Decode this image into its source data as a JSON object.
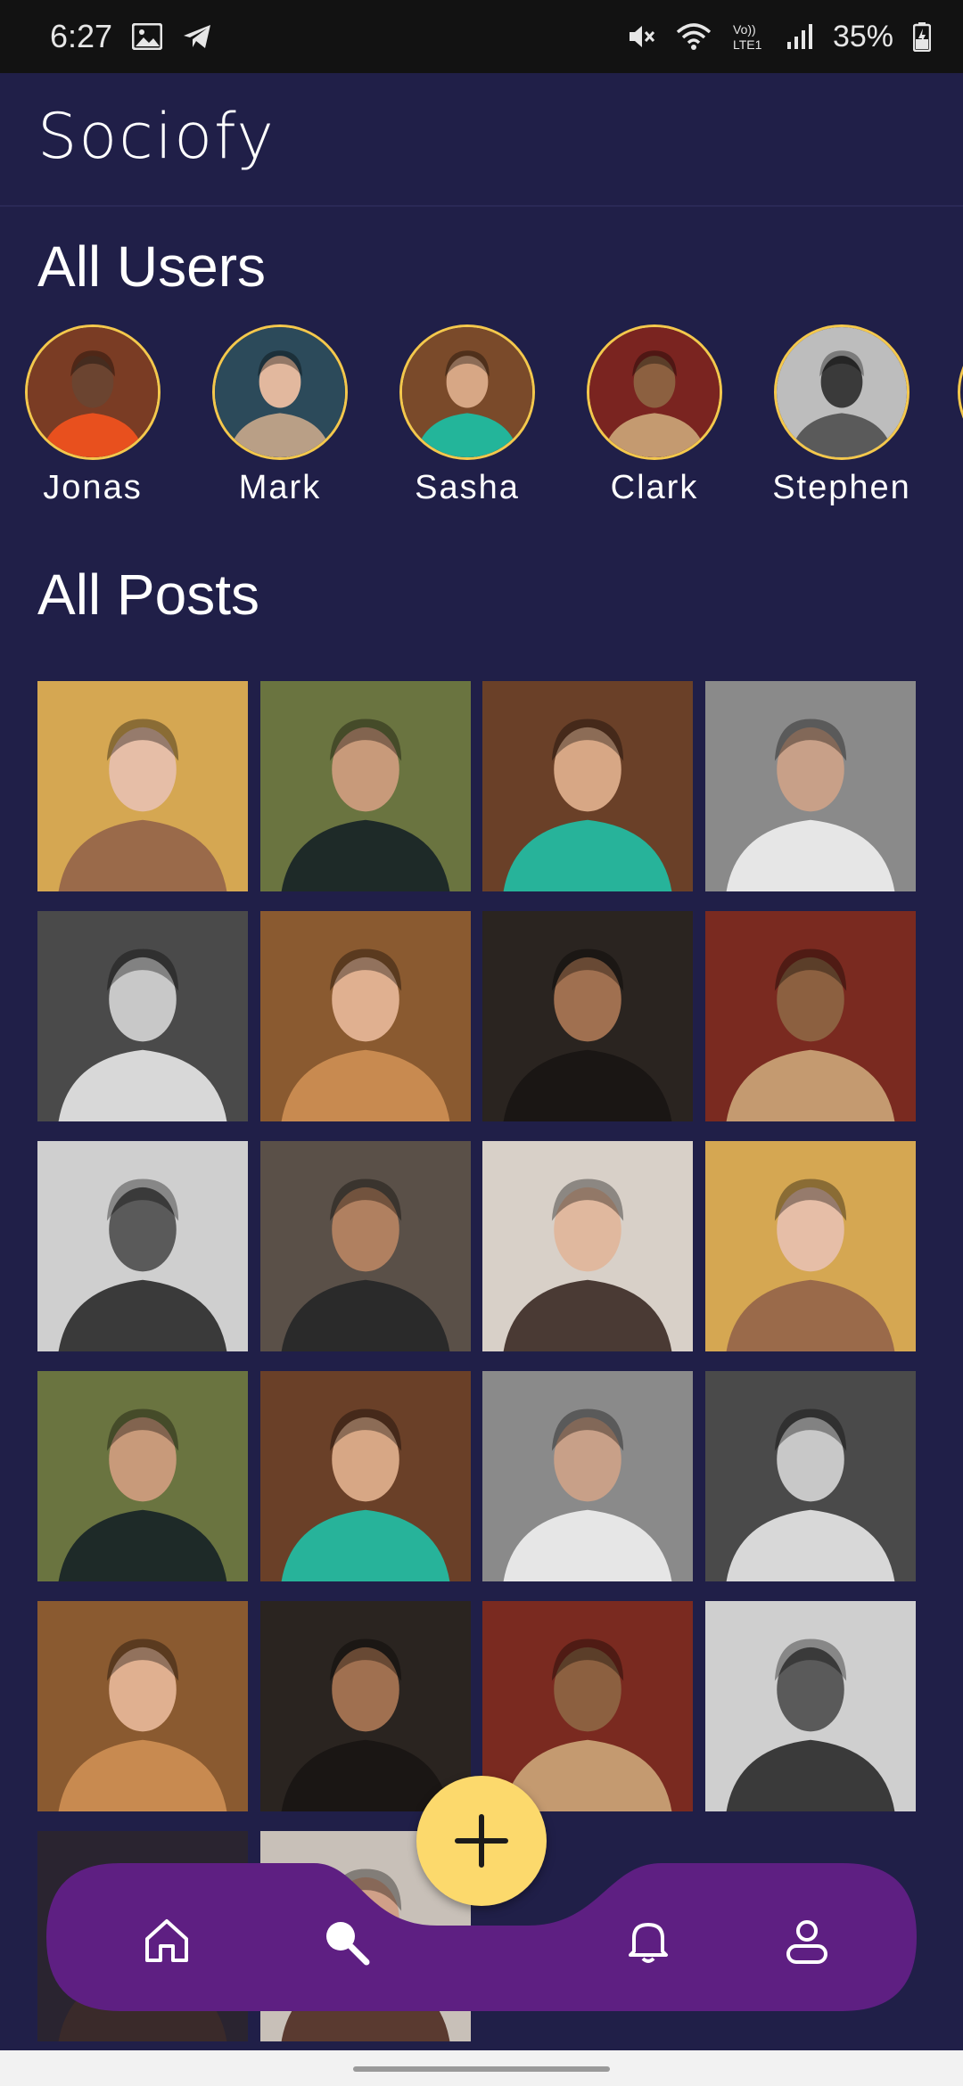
{
  "status_bar": {
    "time": "6:27",
    "battery": "35%",
    "icons_left": [
      "gallery-icon",
      "telegram-icon"
    ],
    "icons_right": [
      "mute-icon",
      "wifi-icon",
      "volte-icon",
      "signal-icon",
      "battery-icon"
    ]
  },
  "app": {
    "title": "Sociofy"
  },
  "users_section": {
    "title": "All Users",
    "users": [
      {
        "name": "Jonas",
        "bg": "#7a3c24",
        "fg": "#e8501e",
        "skin": "#6b4430"
      },
      {
        "name": "Mark",
        "bg": "#2c4a5a",
        "fg": "#b99f86",
        "skin": "#e2b89e"
      },
      {
        "name": "Sasha",
        "bg": "#7a4a2a",
        "fg": "#23b59a",
        "skin": "#d7a785"
      },
      {
        "name": "Clark",
        "bg": "#7a2420",
        "fg": "#c49a70",
        "skin": "#8c6040"
      },
      {
        "name": "Stephen",
        "bg": "#bdbdbd",
        "fg": "#5a5a5a",
        "skin": "#3a3a3a"
      }
    ]
  },
  "posts_section": {
    "title": "All Posts",
    "posts": [
      {
        "bg": "#d5a752",
        "fg": "#9a6a4a",
        "face": "#e6bea7"
      },
      {
        "bg": "#6a7440",
        "fg": "#1e2a28",
        "face": "#c89a7a"
      },
      {
        "bg": "#6a4028",
        "fg": "#27b39a",
        "face": "#d7a785"
      },
      {
        "bg": "#8a8a8a",
        "fg": "#e6e6e6",
        "face": "#c8a088"
      },
      {
        "bg": "#4a4a4a",
        "fg": "#d8d8d8",
        "face": "#c8c8c8"
      },
      {
        "bg": "#8a5a30",
        "fg": "#c88a50",
        "face": "#e0b090"
      },
      {
        "bg": "#2a2420",
        "fg": "#1a1614",
        "face": "#a07050"
      },
      {
        "bg": "#7a2a20",
        "fg": "#c49a70",
        "face": "#8c6040"
      },
      {
        "bg": "#cfcfcf",
        "fg": "#3a3a3a",
        "face": "#5a5a5a"
      },
      {
        "bg": "#5a5048",
        "fg": "#2a2a2a",
        "face": "#b08060"
      },
      {
        "bg": "#d8d0c8",
        "fg": "#4a3a34",
        "face": "#e0b89e"
      },
      {
        "bg": "#d5a752",
        "fg": "#9a6a4a",
        "face": "#e6bea7"
      },
      {
        "bg": "#6a7440",
        "fg": "#1e2a28",
        "face": "#c89a7a"
      },
      {
        "bg": "#6a4028",
        "fg": "#27b39a",
        "face": "#d7a785"
      },
      {
        "bg": "#8a8a8a",
        "fg": "#e6e6e6",
        "face": "#c8a088"
      },
      {
        "bg": "#4a4a4a",
        "fg": "#d8d8d8",
        "face": "#c8c8c8"
      },
      {
        "bg": "#8a5a30",
        "fg": "#c88a50",
        "face": "#e0b090"
      },
      {
        "bg": "#2a2420",
        "fg": "#1a1614",
        "face": "#a07050"
      },
      {
        "bg": "#7a2a20",
        "fg": "#c49a70",
        "face": "#8c6040"
      },
      {
        "bg": "#cfcfcf",
        "fg": "#3a3a3a",
        "face": "#5a5a5a"
      },
      {
        "bg": "#2a2430",
        "fg": "#3a2a2a",
        "face": "#6a4a3a"
      },
      {
        "bg": "#c8c0b8",
        "fg": "#5a3a30",
        "face": "#d0a088"
      }
    ]
  },
  "bottom_nav": {
    "color": "#5e1f82",
    "items": [
      "home-icon",
      "search-icon",
      "bell-icon",
      "profile-icon"
    ],
    "fab_icon": "plus-icon",
    "fab_color": "#fcd96c"
  }
}
